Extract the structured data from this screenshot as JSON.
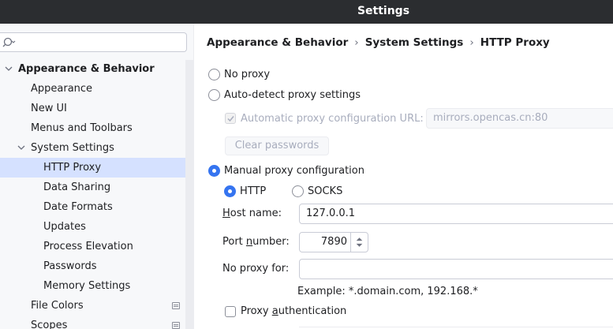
{
  "window": {
    "title": "Settings"
  },
  "search": {
    "placeholder": ""
  },
  "sidebar": {
    "items": [
      {
        "label": "Appearance & Behavior"
      },
      {
        "label": "Appearance"
      },
      {
        "label": "New UI"
      },
      {
        "label": "Menus and Toolbars"
      },
      {
        "label": "System Settings"
      },
      {
        "label": "HTTP Proxy"
      },
      {
        "label": "Data Sharing"
      },
      {
        "label": "Date Formats"
      },
      {
        "label": "Updates"
      },
      {
        "label": "Process Elevation"
      },
      {
        "label": "Passwords"
      },
      {
        "label": "Memory Settings"
      },
      {
        "label": "File Colors"
      },
      {
        "label": "Scopes"
      }
    ]
  },
  "breadcrumb": [
    "Appearance & Behavior",
    "System Settings",
    "HTTP Proxy"
  ],
  "breadcrumb_sep": "›",
  "proxy": {
    "no_proxy": "No proxy",
    "auto_detect": "Auto-detect proxy settings",
    "auto_config_label": "Automatic proxy configuration URL:",
    "auto_config_url": "mirrors.opencas.cn:80",
    "clear_passwords": "Clear passwords",
    "manual": "Manual proxy configuration",
    "http": "HTTP",
    "socks": "SOCKS",
    "host_label_first": "H",
    "host_label_rest": "ost name:",
    "host_value": "127.0.0.1",
    "port_label_pre": "Port ",
    "port_label_u": "n",
    "port_label_rest": "umber:",
    "port_value": "7890",
    "no_proxy_for_label": "No proxy for:",
    "no_proxy_for_value": "",
    "example": "Example: *.domain.com, 192.168.*",
    "auth_pre": "Proxy ",
    "auth_u": "a",
    "auth_rest": "uthentication"
  },
  "colors": {
    "accent": "#3574f0",
    "selection": "#d5e1ff",
    "titlebar": "#2b2d30"
  }
}
